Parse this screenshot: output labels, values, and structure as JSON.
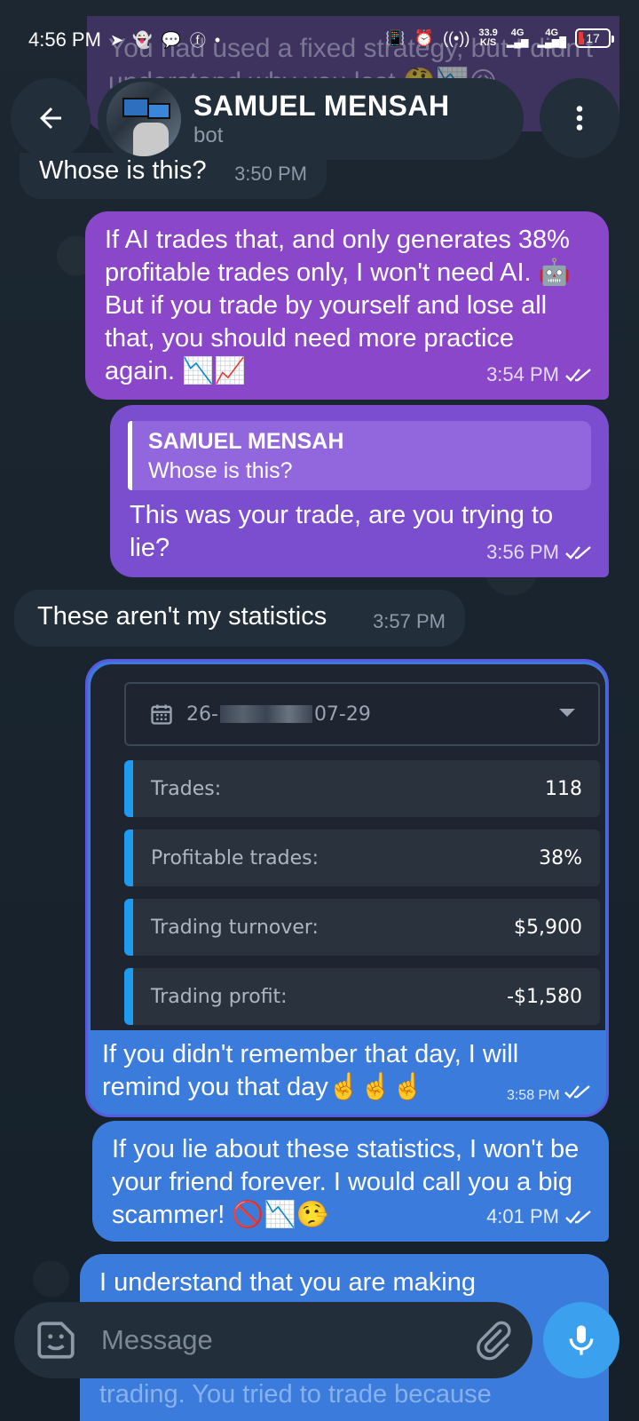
{
  "status_bar": {
    "time": "4:56 PM",
    "net_speed_top": "33.9",
    "net_speed_unit": "K/S",
    "signal1": "4G",
    "signal2": "4G",
    "battery": "17"
  },
  "background_message": {
    "text": "You had used a fixed strategy, but I didn't understand why you lost 🤔📉😥"
  },
  "header": {
    "chat_name": "SAMUEL MENSAH",
    "chat_subtitle": "bot"
  },
  "messages": [
    {
      "text": "Whose is this?",
      "time": "3:50 PM"
    },
    {
      "text": "If AI trades that, and only generates 38% profitable trades only, I won't need AI. 🤖 But if you trade by yourself and lose all that, you should need more practice again. 📉📈",
      "time": "3:54 PM"
    },
    {
      "reply_name": "SAMUEL MENSAH",
      "reply_text": "Whose is this?",
      "text": "This was your trade, are you trying to lie?",
      "time": "3:56 PM"
    },
    {
      "text": "These aren't my statistics",
      "time": "3:57 PM"
    },
    {
      "caption": "If you didn't remember that day, I will remind you that day☝️☝️☝️",
      "time": "3:58 PM"
    },
    {
      "text": "If you lie about these statistics, I won't be your friend forever. I would call you a big scammer! 🚫📉🤥",
      "time": "4:01 PM"
    },
    {
      "text": "I understand that you are making",
      "text_hidden": "trading. You tried to trade because"
    }
  ],
  "stats_image": {
    "date_prefix": "26-",
    "date_suffix": "07-29",
    "rows": [
      {
        "label": "Trades:",
        "value": "118"
      },
      {
        "label": "Profitable trades:",
        "value": "38%"
      },
      {
        "label": "Trading turnover:",
        "value": "$5,900"
      },
      {
        "label": "Trading profit:",
        "value": "-$1,580"
      }
    ]
  },
  "composer": {
    "placeholder": "Message"
  },
  "colors": {
    "background": "#17212b",
    "incoming": "#222e3a",
    "outgoing_purple": "#8a47c9",
    "outgoing_blue": "#3a7bdc",
    "accent": "#3ba0ee",
    "stat_bar": "#1e9bf0"
  },
  "icons": [
    "back-arrow-icon",
    "more-vert-icon",
    "double-check-icon",
    "calendar-icon",
    "sticker-icon",
    "attach-icon",
    "mic-icon"
  ]
}
